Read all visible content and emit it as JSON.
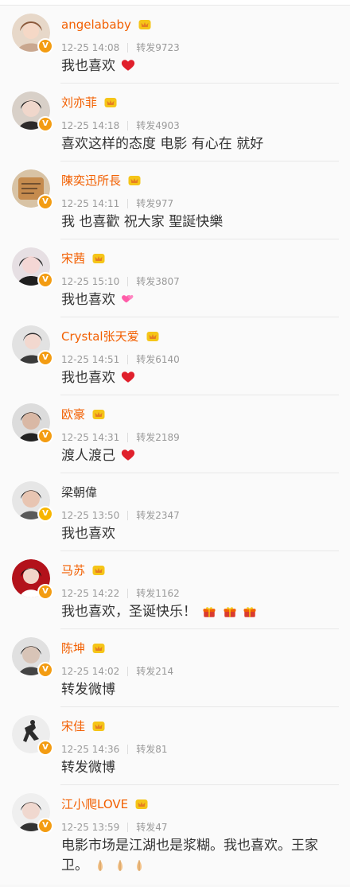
{
  "items": [
    {
      "name": "angelababy",
      "time": "12-25 14:08",
      "reposts": "转发9723",
      "text": "我也喜欢",
      "emoji": "heart-icon"
    },
    {
      "name": "刘亦菲",
      "time": "12-25 14:18",
      "reposts": "转发4903",
      "text": "喜欢这样的态度 电影 有心在 就好"
    },
    {
      "name": "陳奕迅所長",
      "time": "12-25 14:11",
      "reposts": "转发977",
      "text": "我  也喜歡 祝大家 聖誕快樂"
    },
    {
      "name": "宋茜",
      "time": "12-25 15:10",
      "reposts": "转发3807",
      "text": "我也喜欢",
      "emoji": "two-hearts-icon"
    },
    {
      "name": "Crystal张天爱",
      "time": "12-25 14:51",
      "reposts": "转发6140",
      "text": "我也喜欢",
      "emoji": "heart-icon"
    },
    {
      "name": "欧豪",
      "time": "12-25 14:31",
      "reposts": "转发2189",
      "text": "渡人渡己",
      "emoji": "heart-icon"
    },
    {
      "name": "梁朝偉",
      "time": "12-25 13:50",
      "reposts": "转发2347",
      "text": "我也喜欢"
    },
    {
      "name": "马苏",
      "time": "12-25 14:22",
      "reposts": "转发1162",
      "text": "我也喜欢，圣诞快乐！",
      "emoji": "gift-icon"
    },
    {
      "name": "陈坤",
      "time": "12-25 14:02",
      "reposts": "转发214",
      "text": "转发微博"
    },
    {
      "name": "宋佳",
      "time": "12-25 14:36",
      "reposts": "转发81",
      "text": "转发微博"
    },
    {
      "name": "江小爬LOVE",
      "time": "12-25 13:59",
      "reposts": "转发47",
      "text": "电影市场是江湖也是浆糊。我也喜欢。王家卫。",
      "emoji": "praying-hands-icon"
    }
  ],
  "colors": {
    "name_orange": "#f25f00",
    "name_plain": "#333333",
    "meta_gray": "#999999",
    "badge_orange": "#f39c12",
    "heart_red": "#e0202c",
    "pink_heart": "#ff5ca8",
    "gift_red": "#d93b2f",
    "gold": "#f5c518"
  }
}
